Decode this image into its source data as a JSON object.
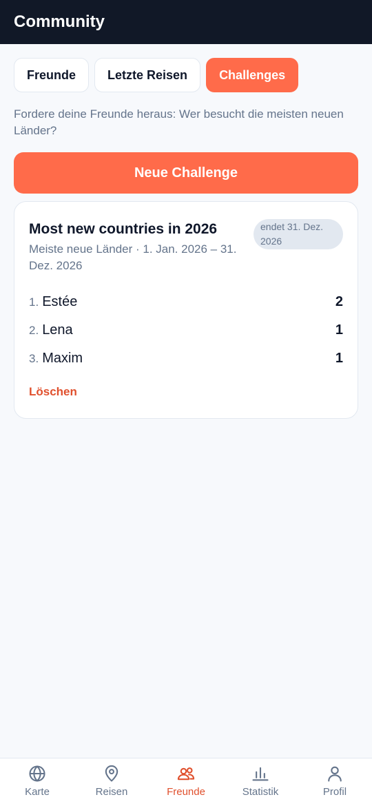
{
  "header": {
    "title": "Community"
  },
  "tabs": [
    {
      "label": "Freunde"
    },
    {
      "label": "Letzte Reisen"
    },
    {
      "label": "Challenges"
    }
  ],
  "intro_text": "Fordere deine Freunde heraus: Wer besucht die meisten neuen Länder?",
  "new_challenge_label": "Neue Challenge",
  "challenge": {
    "title": "Most new countries in 2026",
    "subtitle": "Meiste neue Länder · 1. Jan. 2026 – 31. Dez. 2026",
    "badge": "endet 31. Dez. 2026",
    "ranking": [
      {
        "rank": "1.",
        "name": "Estée",
        "score": "2"
      },
      {
        "rank": "2.",
        "name": "Lena",
        "score": "1"
      },
      {
        "rank": "3.",
        "name": "Maxim",
        "score": "1"
      }
    ],
    "delete_label": "Löschen"
  },
  "nav": [
    {
      "label": "Karte",
      "icon": "globe-icon"
    },
    {
      "label": "Reisen",
      "icon": "map-pin-icon"
    },
    {
      "label": "Freunde",
      "icon": "users-icon"
    },
    {
      "label": "Statistik",
      "icon": "bar-chart-icon"
    },
    {
      "label": "Profil",
      "icon": "user-icon"
    }
  ],
  "colors": {
    "accent": "#ff6b4a",
    "accent_text": "#e0502d",
    "header_bg": "#111827",
    "background": "#f7f9fc"
  }
}
